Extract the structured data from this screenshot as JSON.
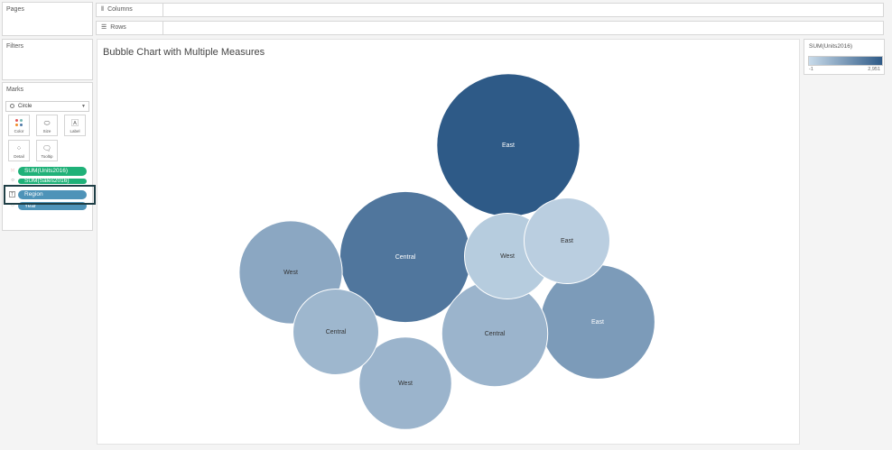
{
  "panels": {
    "pages": "Pages",
    "filters": "Filters",
    "marks": "Marks"
  },
  "marks": {
    "type": "Circle",
    "buttons": {
      "color": "Color",
      "size": "Size",
      "label": "Label",
      "detail": "Detail",
      "tooltip": "Tooltip"
    },
    "pills": {
      "units": "SUM(Units2016)",
      "sales": "SUM(Sales2016)",
      "region": "Region",
      "year": "Year"
    }
  },
  "shelves": {
    "columns": "Columns",
    "rows": "Rows"
  },
  "legend": {
    "title": "SUM(Units2016)",
    "min": "-1",
    "max": "2,951",
    "min_color": "#c9dbea",
    "max_color": "#2e5a87"
  },
  "colors": {
    "measure_pill": "#1fb178",
    "dimension_pill": "#4e93b8",
    "highlight_border": "#1f3f46"
  },
  "chart_data": {
    "type": "scatter",
    "title": "Bubble Chart with Multiple Measures",
    "color_measure": "SUM(Units2016)",
    "size_measure": "SUM(Sales2016)",
    "label_field": "Region",
    "bubbles": [
      {
        "label": "East",
        "size": 100,
        "color_value": 1.0
      },
      {
        "label": "Central",
        "size": 84,
        "color_value": 0.78
      },
      {
        "label": "East",
        "size": 64,
        "color_value": 0.5
      },
      {
        "label": "West",
        "size": 52,
        "color_value": 0.4
      },
      {
        "label": "West",
        "size": 42,
        "color_value": 0.3
      },
      {
        "label": "Central",
        "size": 36,
        "color_value": 0.28
      },
      {
        "label": "Central",
        "size": 55,
        "color_value": 0.3
      },
      {
        "label": "West",
        "size": 36,
        "color_value": 0.12
      },
      {
        "label": "East",
        "size": 36,
        "color_value": 0.1
      }
    ]
  }
}
